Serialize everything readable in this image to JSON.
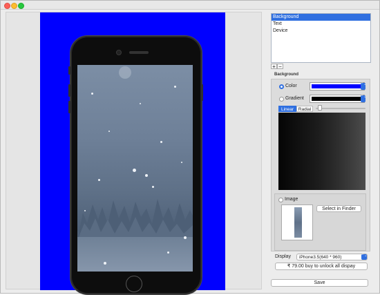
{
  "window": {
    "traffic_lights": [
      "close",
      "minimize",
      "zoom"
    ]
  },
  "colors": {
    "canvas_background": "#0000ff",
    "accent": "#2f6fe0",
    "panel": "#ececec"
  },
  "layers": {
    "items": [
      "Background",
      "Text",
      "Device"
    ],
    "selected": "Background"
  },
  "layer_controls": {
    "add": "+",
    "remove": "−"
  },
  "background_section": {
    "title": "Background",
    "color_option": "Color",
    "gradient_option": "Gradient",
    "selected_option": "Color",
    "color_well": "#0000ff",
    "gradient_well": "#000000",
    "gradient_type_tabs": [
      "Linear",
      "Radial"
    ],
    "gradient_type_selected": "Linear"
  },
  "image_section": {
    "label": "Image",
    "select_button": "Select in Finder"
  },
  "display": {
    "label": "Display",
    "selected": "iPhone3.5(640 * 960)"
  },
  "purchase_button": "₹ 79.00 buy to unlock all dispay",
  "save_button": "Save"
}
